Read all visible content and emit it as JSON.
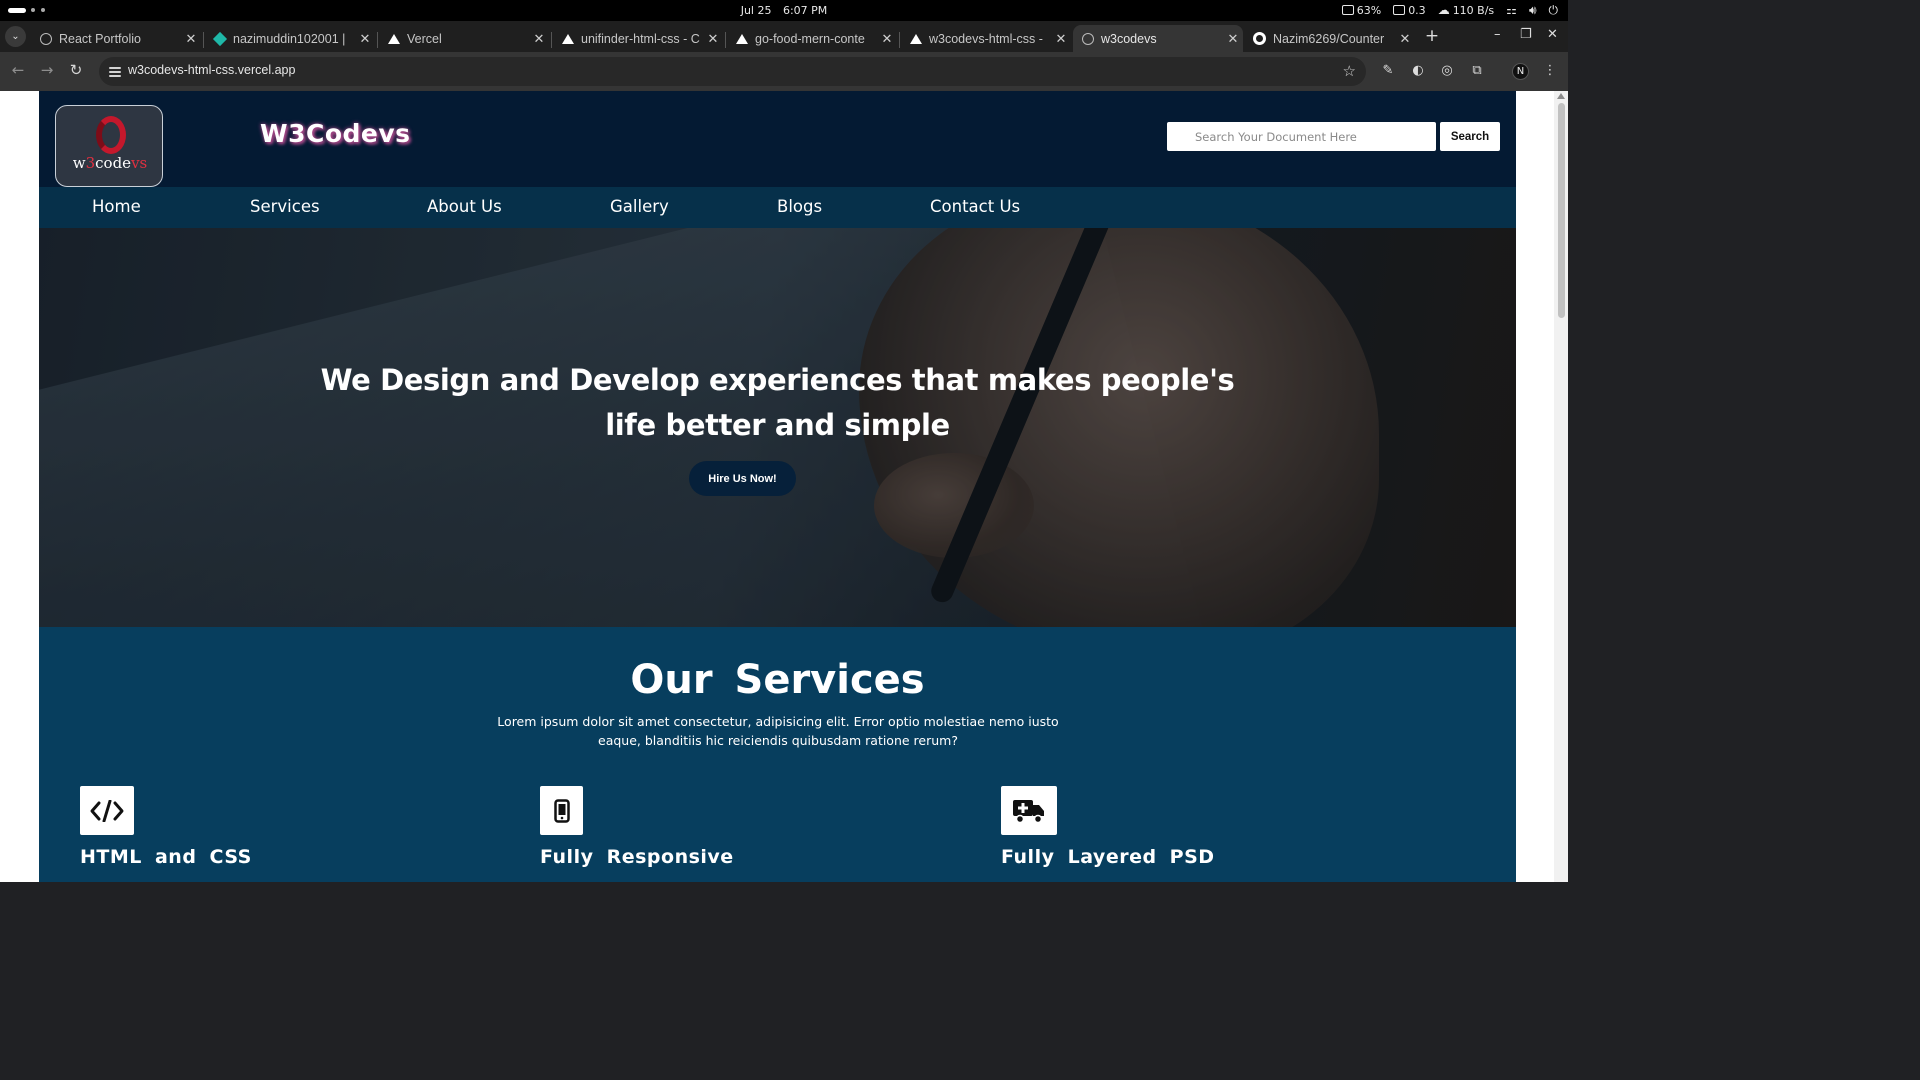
{
  "os": {
    "date": "Jul 25",
    "time": "6:07 PM",
    "battery": "63%",
    "cpu": "0.3",
    "network": "110 B/s"
  },
  "tabs": [
    {
      "label": "React Portfolio",
      "icon": "globe-icon"
    },
    {
      "label": "nazimuddin102001 |",
      "icon": "diamond-icon"
    },
    {
      "label": "Vercel",
      "icon": "vercel-icon"
    },
    {
      "label": "unifinder-html-css - C",
      "icon": "vercel-icon"
    },
    {
      "label": "go-food-mern-conte",
      "icon": "vercel-icon"
    },
    {
      "label": "w3codevs-html-css - ",
      "icon": "vercel-icon"
    },
    {
      "label": "w3codevs",
      "icon": "globe-icon",
      "active": true
    },
    {
      "label": "Nazim6269/Counter",
      "icon": "github-icon"
    }
  ],
  "address": {
    "url": "w3codevs-html-css.vercel.app"
  },
  "site": {
    "logo_text": {
      "a": "w",
      "b": "3",
      "c": "code",
      "d": "vs"
    },
    "brand": "W3Codevs",
    "search": {
      "placeholder": "Search Your Document Here",
      "button": "Search"
    },
    "nav": [
      "Home",
      "Services",
      "About Us",
      "Gallery",
      "Blogs",
      "Contact Us"
    ],
    "hero": {
      "headline": "We Design and Develop experiences that makes people's life better and simple",
      "cta": "Hire Us Now!"
    },
    "services": {
      "title": "Our Services",
      "description": "Lorem ipsum dolor sit amet consectetur, adipisicing elit. Error optio molestiae nemo iusto eaque, blanditiis hic reiciendis quibusdam ratione rerum?",
      "items": [
        {
          "title": "HTML and CSS",
          "icon": "code-icon"
        },
        {
          "title": "Fully Responsive",
          "icon": "mobile-icon"
        },
        {
          "title": "Fully Layered PSD",
          "icon": "truck-medical-icon"
        }
      ]
    },
    "colors": {
      "header": "#041a33",
      "menu": "#06304a",
      "services_bg": "#073e5e",
      "cta_bg": "#06203a",
      "brand_shadow": "#b04a8c"
    }
  }
}
